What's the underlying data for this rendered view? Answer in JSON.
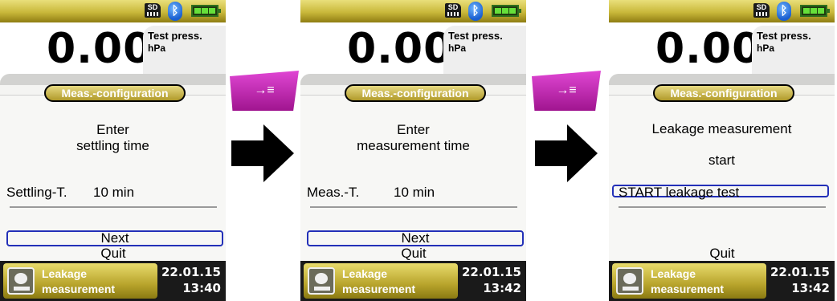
{
  "screens": [
    {
      "reading_value": "0.00",
      "unit_title": "Test press.",
      "unit": "hPa",
      "config_title": "Meas.-configuration",
      "prompt_line1": "Enter",
      "prompt_line2": "settling time",
      "param_label": "Settling-T.",
      "param_value": "10 min",
      "menu": [
        "Next",
        "Quit"
      ],
      "selected_index": 0,
      "footer_label1": "Leakage",
      "footer_label2": "measurement",
      "date": "22.01.15",
      "time": "13:40"
    },
    {
      "reading_value": "0.00",
      "unit_title": "Test press.",
      "unit": "hPa",
      "config_title": "Meas.-configuration",
      "prompt_line1": "Enter",
      "prompt_line2": "measurement time",
      "param_label": "Meas.-T.",
      "param_value": "10 min",
      "menu": [
        "Next",
        "Quit"
      ],
      "selected_index": 0,
      "footer_label1": "Leakage",
      "footer_label2": "measurement",
      "date": "22.01.15",
      "time": "13:42"
    },
    {
      "reading_value": "0.00",
      "unit_title": "Test press.",
      "unit": "hPa",
      "config_title": "Meas.-configuration",
      "prompt_line1": "Leakage measurement",
      "prompt_line2": "start",
      "action_label": "START leakage test",
      "menu": [
        "Quit"
      ],
      "footer_label1": "Leakage",
      "footer_label2": "measurement",
      "date": "22.01.15",
      "time": "13:42"
    }
  ],
  "status_icons": {
    "sd": "SD",
    "bluetooth": "bluetooth-icon",
    "battery": "battery-icon"
  },
  "softkey_symbol": "→≡",
  "colors": {
    "header_gold": "#c9b83a",
    "softkey_magenta": "#c42bb6",
    "selection_blue": "#2330b8",
    "footer_dark": "#1a1a1a"
  }
}
